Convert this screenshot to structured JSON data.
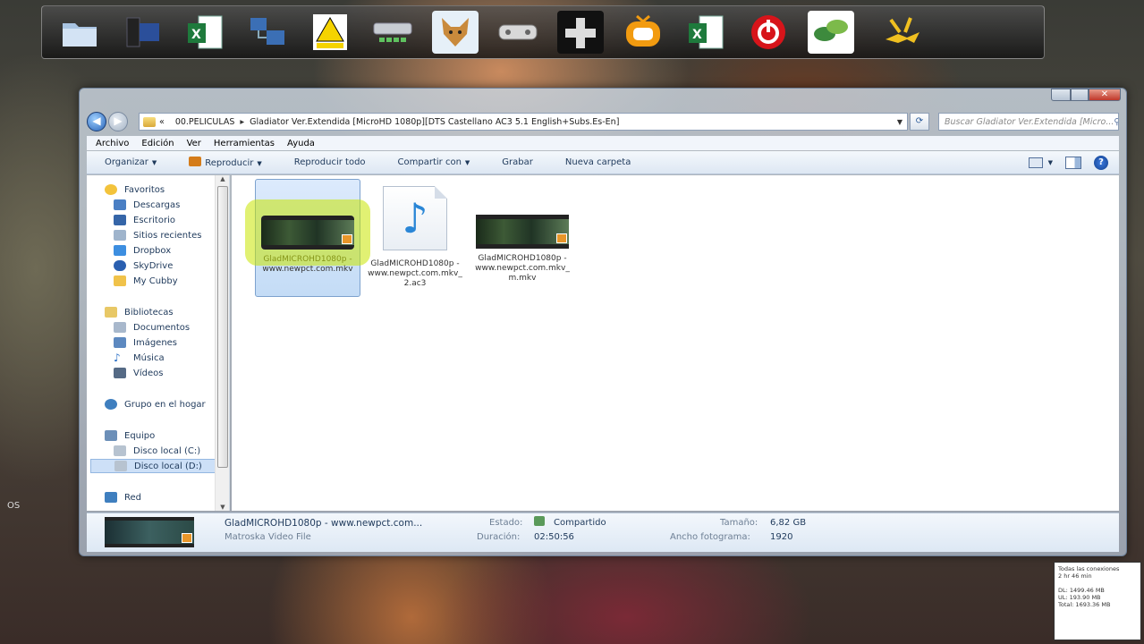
{
  "desktop": {
    "edge_label": "OS"
  },
  "dock": {
    "icons": [
      "folder-icon",
      "computer-icon",
      "excel-icon",
      "network-icon",
      "warning-sign-icon",
      "drive-icon",
      "fox-icon",
      "gamepad-icon",
      "dpad-icon",
      "tv-icon",
      "excel-icon",
      "power-icon",
      "leaf-icon",
      "flag-icon"
    ]
  },
  "window": {
    "breadcrumb": [
      "00.PELICULAS",
      "Gladiator Ver.Extendida [MicroHD 1080p][DTS Castellano AC3 5.1 English+Subs.Es-En]"
    ],
    "breadcrumb_prefix": "«",
    "search_placeholder": "Buscar Gladiator Ver.Extendida [Micro...",
    "menu": [
      "Archivo",
      "Edición",
      "Ver",
      "Herramientas",
      "Ayuda"
    ],
    "toolbar": {
      "organize": "Organizar",
      "play": "Reproducir",
      "play_all": "Reproducir todo",
      "share": "Compartir con",
      "burn": "Grabar",
      "new_folder": "Nueva carpeta"
    },
    "nav": {
      "favorites": "Favoritos",
      "downloads": "Descargas",
      "desktop": "Escritorio",
      "recent": "Sitios recientes",
      "dropbox": "Dropbox",
      "skydrive": "SkyDrive",
      "cubby": "My Cubby",
      "libraries": "Bibliotecas",
      "documents": "Documentos",
      "images": "Imágenes",
      "music": "Música",
      "videos": "Vídeos",
      "homegroup": "Grupo en el hogar",
      "computer": "Equipo",
      "disk_c": "Disco local (C:)",
      "disk_d": "Disco local (D:)",
      "network": "Red"
    },
    "files": [
      {
        "name": "GladMICROHD1080p - www.newpct.com.mkv",
        "type": "video",
        "selected": true
      },
      {
        "name": "GladMICROHD1080p - www.newpct.com.mkv_2.ac3",
        "type": "audio",
        "selected": false
      },
      {
        "name": "GladMICROHD1080p - www.newpct.com.mkv_m.mkv",
        "type": "video",
        "selected": false
      }
    ],
    "details": {
      "filename": "GladMICROHD1080p - www.newpct.com...",
      "filetype": "Matroska Video File",
      "state_label": "Estado:",
      "state_value": "Compartido",
      "duration_label": "Duración:",
      "duration_value": "02:50:56",
      "size_label": "Tamaño:",
      "size_value": "6,82 GB",
      "width_label": "Ancho fotograma:",
      "width_value": "1920"
    }
  },
  "tray_widget": {
    "line1": "Todas las conexiones",
    "line2": "2 hr 46 min",
    "dl": "DL: 1499.46 MB",
    "ul": "UL: 193.90 MB",
    "total": "Total: 1693.36 MB"
  }
}
